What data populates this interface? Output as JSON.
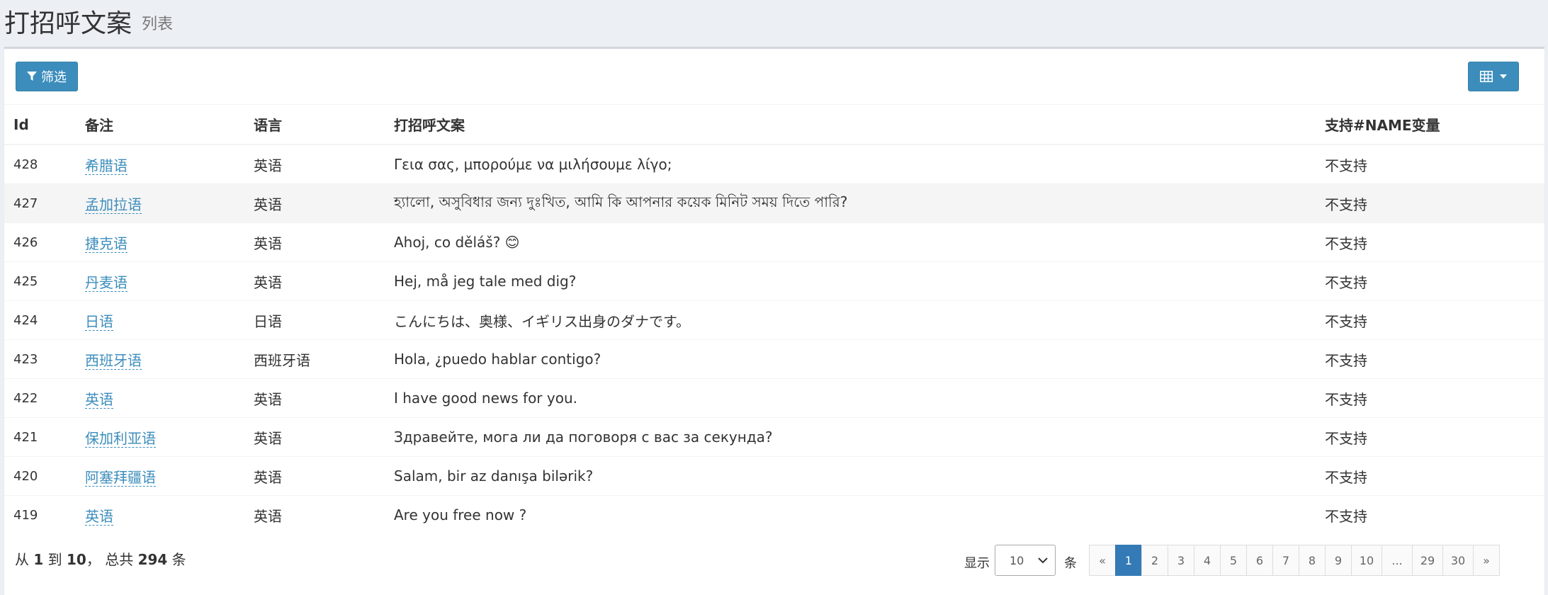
{
  "header": {
    "title": "打招呼文案",
    "subtitle": "列表"
  },
  "toolbar": {
    "filter_label": "筛选"
  },
  "table": {
    "columns": [
      "Id",
      "备注",
      "语言",
      "打招呼文案",
      "支持#NAME变量"
    ],
    "rows": [
      {
        "id": "428",
        "note": "希腊语",
        "lang": "英语",
        "text": "Γεια σας, μπορούμε να μιλήσουμε λίγο;",
        "support": "不支持"
      },
      {
        "id": "427",
        "note": "孟加拉语",
        "lang": "英语",
        "text": "হ্যালো, অসুবিধার জন্য দুঃখিত, আমি কি আপনার কয়েক মিনিট সময় দিতে পারি?",
        "support": "不支持"
      },
      {
        "id": "426",
        "note": "捷克语",
        "lang": "英语",
        "text": "Ahoj, co děláš? 😊",
        "support": "不支持"
      },
      {
        "id": "425",
        "note": "丹麦语",
        "lang": "英语",
        "text": "Hej, må jeg tale med dig?",
        "support": "不支持"
      },
      {
        "id": "424",
        "note": "日语",
        "lang": "日语",
        "text": "こんにちは、奥様、イギリス出身のダナです。",
        "support": "不支持"
      },
      {
        "id": "423",
        "note": "西班牙语",
        "lang": "西班牙语",
        "text": "Hola, ¿puedo hablar contigo?",
        "support": "不支持"
      },
      {
        "id": "422",
        "note": "英语",
        "lang": "英语",
        "text": "I have good news for you.",
        "support": "不支持"
      },
      {
        "id": "421",
        "note": "保加利亚语",
        "lang": "英语",
        "text": "Здравейте, мога ли да поговоря с вас за секунда?",
        "support": "不支持"
      },
      {
        "id": "420",
        "note": "阿塞拜疆语",
        "lang": "英语",
        "text": "Salam, bir az danışa bilərik?",
        "support": "不支持"
      },
      {
        "id": "419",
        "note": "英语",
        "lang": "英语",
        "text": "Are you free now ?",
        "support": "不支持"
      }
    ]
  },
  "footer": {
    "summary_prefix": "从",
    "from": "1",
    "to_word": "到",
    "to": "10",
    "total_word": "， 总共",
    "total": "294",
    "unit": "条",
    "show_label": "显示",
    "page_size": "10",
    "page_size_unit": "条"
  },
  "pagination": [
    "«",
    "1",
    "2",
    "3",
    "4",
    "5",
    "6",
    "7",
    "8",
    "9",
    "10",
    "...",
    "29",
    "30",
    "»"
  ],
  "colors": {
    "primary": "#3c8dbc",
    "active_page": "#337ab7"
  }
}
